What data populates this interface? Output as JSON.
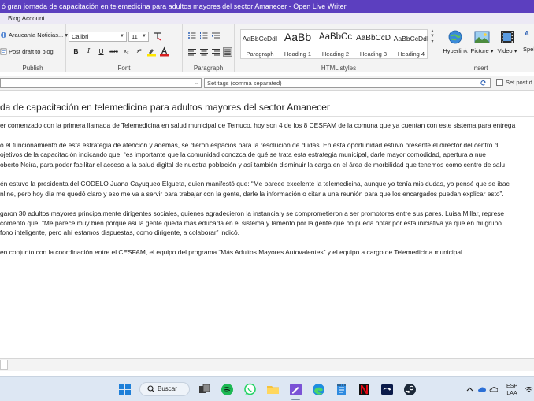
{
  "window": {
    "title": "ó gran jornada de capacitación en telemedicina para adultos mayores del sector Amanecer - Open Live Writer"
  },
  "menu": {
    "tab": "Blog Account"
  },
  "ribbon": {
    "publish": {
      "blog_selector": "Araucanía Noticias...",
      "post_draft": "Post draft to blog",
      "label": "Publish"
    },
    "font": {
      "family": "Calibri",
      "size": "11",
      "label": "Font",
      "bold": "B",
      "italic": "I",
      "underline": "U",
      "strikethrough": "abc",
      "subscript": "x₂",
      "superscript": "x²"
    },
    "paragraph": {
      "label": "Paragraph"
    },
    "html_styles": {
      "label": "HTML styles",
      "items": [
        {
          "preview": "AaBbCcDdI",
          "name": "Paragraph"
        },
        {
          "preview": "AaBb",
          "name": "Heading 1"
        },
        {
          "preview": "AaBbCc",
          "name": "Heading 2"
        },
        {
          "preview": "AaBbCcD",
          "name": "Heading 3"
        },
        {
          "preview": "AaBbCcDdI",
          "name": "Heading 4"
        }
      ]
    },
    "insert": {
      "label": "Insert",
      "items": [
        {
          "name": "Hyperlink"
        },
        {
          "name": "Picture"
        },
        {
          "name": "Video"
        }
      ]
    },
    "more": {
      "top": "A",
      "bottom": "Spel"
    }
  },
  "tagbar": {
    "tags_placeholder": "Set tags (comma separated)",
    "set_post": "Set post d"
  },
  "post": {
    "title": "da de capacitación en telemedicina para adultos mayores del sector Amanecer",
    "paragraphs": [
      [
        "er comenzado con la primera llamada de Telemedicina en salud municipal de Temuco, hoy son 4 de los 8 CESFAM de la comuna que ya cuentan con este sistema para entrega"
      ],
      [
        "o el funcionamiento de esta estrategia de atención y además, se dieron espacios para la resolución de dudas. En esta oportunidad estuvo presente el director del centro d",
        "ojetivos de la capacitación indicando que: “es importante que la comunidad conozca de qué se trata esta estrategia municipal, darle mayor comodidad, apertura a nue",
        "oberto Neira, para poder facilitar el acceso a la salud digital de nuestra población y así también disminuir la carga en el área de morbilidad que tenemos como centro de salu"
      ],
      [
        "én estuvo la presidenta del CODELO Juana Cayuqueo Elgueta, quien manifestó que: “Me parece excelente la telemedicina, aunque yo tenía mis dudas, yo pensé que se ibac",
        "nline, pero hoy día me quedó claro y eso me va a servir para trabajar con la gente, darle la información o citar a una reunión para que los encargados puedan explicar esto”."
      ],
      [
        "garon 30 adultos mayores principalmente dirigentes sociales, quienes agradecieron la instancia y se comprometieron a ser promotores entre sus pares. Luisa Millar, represe",
        "comentó que: “Me parece muy bien porque así la gente queda más educada en el sistema y lamento por la gente que no pueda optar por esta iniciativa ya que en mi grupo",
        "fono inteligente, pero ahí estamos dispuestas, como dirigente, a colaborar” indicó."
      ],
      [
        "en conjunto con la coordinación entre el CESFAM, el equipo del programa “Más Adultos Mayores Autovalentes” y el equipo a cargo de Telemedicina municipal."
      ]
    ]
  },
  "taskbar": {
    "search_label": "Buscar",
    "lang_top": "ESP",
    "lang_bottom": "LAA"
  },
  "colors": {
    "titlebar": "#5c3fbf",
    "taskbar": "#dde7f3"
  }
}
